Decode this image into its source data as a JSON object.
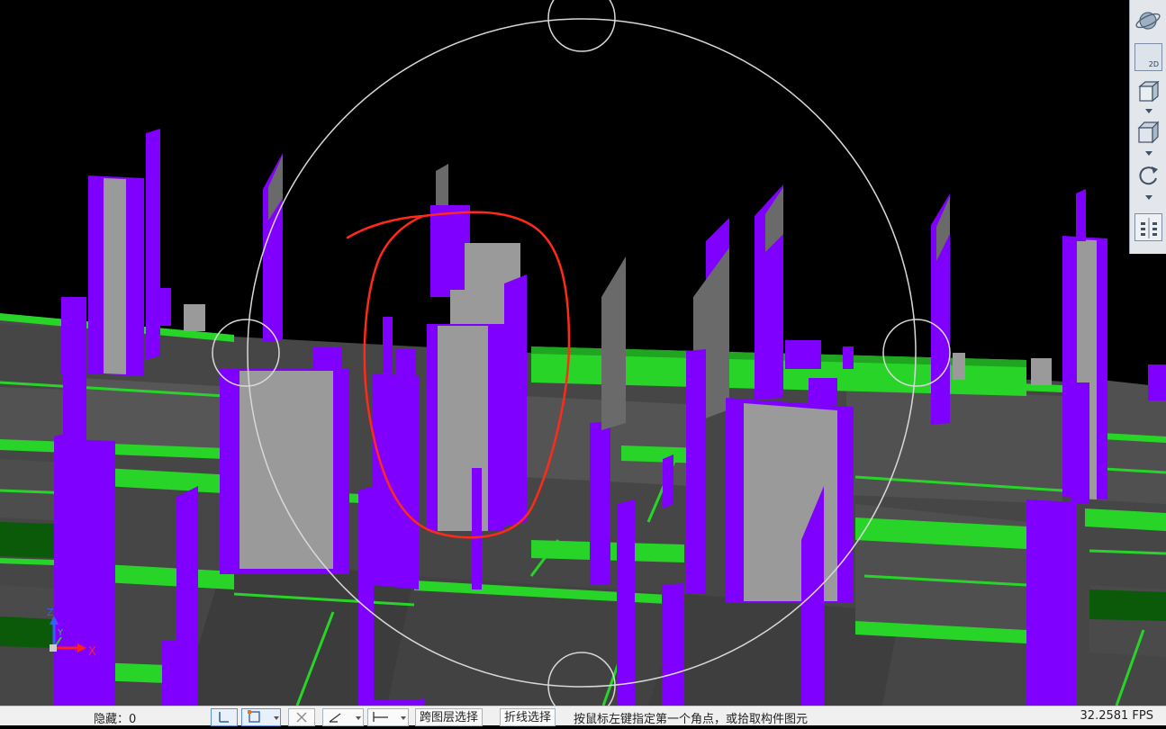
{
  "viewport": {
    "background": "#000000",
    "colors": {
      "wall_purple": "#8000ff",
      "wall_purple_dark": "#5a00b8",
      "wall_gray": "#9a9a9a",
      "slab_gray": "#4a4a4a",
      "beam_green": "#29d429",
      "annotation_red": "#ff2a1a",
      "orbit_circle": "#d8d8d8"
    },
    "axis_gizmo": {
      "x_label": "X",
      "y_label": "Y",
      "z_label": "Z"
    }
  },
  "view_toolbar": {
    "items": [
      {
        "icon": "orbit-sphere-icon"
      },
      {
        "icon": "2d-view-icon",
        "label": "2D"
      },
      {
        "icon": "3d-box-view-icon"
      },
      {
        "icon": "cube-view-icon"
      },
      {
        "icon": "rotate-icon"
      },
      {
        "icon": "display-settings-icon"
      }
    ]
  },
  "status_bar": {
    "hidden_count": "隐藏：0",
    "cross_layer_select": "跨图层选择",
    "polyline_select": "折线选择",
    "prompt": "按鼠标左键指定第一个角点，或拾取构件图元",
    "fps": "32.2581 FPS"
  }
}
